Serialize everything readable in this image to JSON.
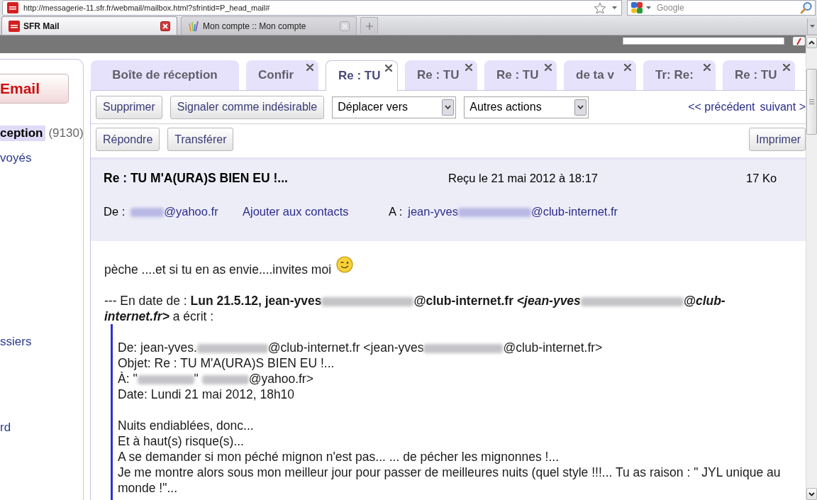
{
  "browser": {
    "url": "http://messagerie-11.sfr.fr/webmail/mailbox.html?sfrintid=P_head_mail#",
    "search": {
      "placeholder": "Google"
    },
    "tabs": [
      {
        "label": "SFR Mail",
        "selected": true
      },
      {
        "label": "Mon compte :: Mon compte",
        "selected": false
      }
    ]
  },
  "sidebar": {
    "compose": "Email",
    "items": [
      {
        "label": "ception",
        "count": "(9130)",
        "selected": true
      },
      {
        "label": "voyés",
        "selected": false
      },
      {
        "label": "ssiers",
        "selected": false
      },
      {
        "label": "rd",
        "selected": false
      }
    ]
  },
  "mail_tabs": [
    {
      "label": "Boîte de réception",
      "closable": false,
      "selected": false
    },
    {
      "label": "Confir",
      "closable": true,
      "selected": false
    },
    {
      "label": "Re : TU",
      "closable": true,
      "selected": true
    },
    {
      "label": "Re : TU",
      "closable": true,
      "selected": false
    },
    {
      "label": "Re : TU",
      "closable": true,
      "selected": false
    },
    {
      "label": "de ta v",
      "closable": true,
      "selected": false
    },
    {
      "label": "Tr: Re:",
      "closable": true,
      "selected": false
    },
    {
      "label": "Re : TU",
      "closable": true,
      "selected": false
    }
  ],
  "toolbar": {
    "buttons": [
      "Supprimer",
      "Signaler comme indésirable"
    ],
    "selects": [
      "Déplacer vers",
      "Autres actions"
    ],
    "previous": "<< précédent",
    "next": "suivant >",
    "actions": [
      "Répondre",
      "Transférer"
    ],
    "print": "Imprimer"
  },
  "message": {
    "subject": "Re : TU M'A(URA)S BIEN EU !...",
    "received": "Reçu le 21 mai 2012 à 18:17",
    "size": "17 Ko",
    "from_label": "De :",
    "from": [
      {
        "kind": "redacted"
      },
      {
        "kind": "plain",
        "text": "@yahoo.fr"
      }
    ],
    "add_contact": "Ajouter aux contacts",
    "to_label": "A :",
    "to": [
      {
        "kind": "plain",
        "text": "jean-yves"
      },
      {
        "kind": "redacted"
      },
      {
        "kind": "plain",
        "text": "@club-internet.fr"
      }
    ]
  },
  "body": {
    "intro": "pèche ....et si tu en as envie....invites moi",
    "quote_header": [
      {
        "kind": "plain",
        "text": "--- En date de : "
      },
      {
        "kind": "bold",
        "text": "Lun 21.5.12, jean-yves"
      },
      {
        "kind": "redacted"
      },
      {
        "kind": "bold",
        "text": "@club-internet.fr "
      },
      {
        "kind": "bold-italic",
        "text": "<jean-yves"
      },
      {
        "kind": "redacted"
      },
      {
        "kind": "bold-italic",
        "text": "@club-internet.fr>"
      },
      {
        "kind": "plain",
        "text": " a écrit :"
      }
    ],
    "quoted_header_lines": [
      [
        {
          "kind": "plain",
          "text": "De: jean-yves."
        },
        {
          "kind": "redacted"
        },
        {
          "kind": "plain",
          "text": "@club-internet.fr <jean-yves"
        },
        {
          "kind": "redacted"
        },
        {
          "kind": "plain",
          "text": "@club-internet.fr>"
        }
      ],
      [
        {
          "kind": "plain",
          "text": "Objet: Re : TU M'A(URA)S BIEN EU !..."
        }
      ],
      [
        {
          "kind": "plain",
          "text": "À: \""
        },
        {
          "kind": "redacted"
        },
        {
          "kind": "plain",
          "text": "\" "
        },
        {
          "kind": "redacted"
        },
        {
          "kind": "plain",
          "text": "@yahoo.fr>"
        }
      ],
      [
        {
          "kind": "plain",
          "text": "Date: Lundi 21 mai 2012, 18h10"
        }
      ]
    ],
    "quoted_lines": [
      "Nuits endiablées, donc...",
      "Et à haut(s) risque(s)...",
      "A se demander si mon péché mignon n'est pas... ... de pécher les mignonnes !...",
      "Je me montre alors sous mon meilleur jour pour passer de meilleures nuits (quel style !!!... Tu as raison : \" JYL unique au monde !\"..."
    ]
  }
}
